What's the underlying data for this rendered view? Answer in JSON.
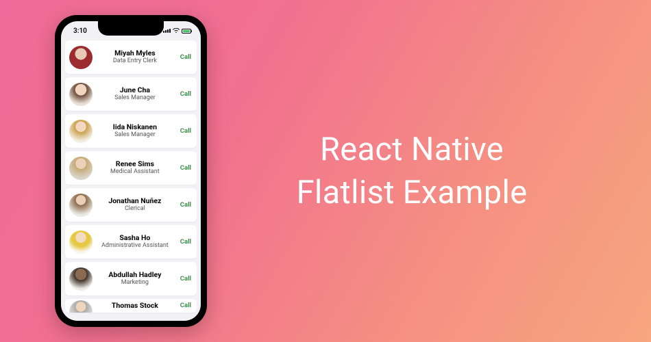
{
  "page_title_line1": "React Native",
  "page_title_line2": "Flatlist Example",
  "status": {
    "time": "3:10"
  },
  "call_label": "Call",
  "contacts": [
    {
      "name": "Miyah Myles",
      "role": "Data Entry Clerk"
    },
    {
      "name": "June Cha",
      "role": "Sales Manager"
    },
    {
      "name": "Iida Niskanen",
      "role": "Sales Manager"
    },
    {
      "name": "Renee Sims",
      "role": "Medical Assistant"
    },
    {
      "name": "Jonathan Nuñez",
      "role": "Clerical"
    },
    {
      "name": "Sasha Ho",
      "role": "Administrative Assistant"
    },
    {
      "name": "Abdullah Hadley",
      "role": "Marketing"
    },
    {
      "name": "Thomas Stock",
      "role": ""
    }
  ]
}
